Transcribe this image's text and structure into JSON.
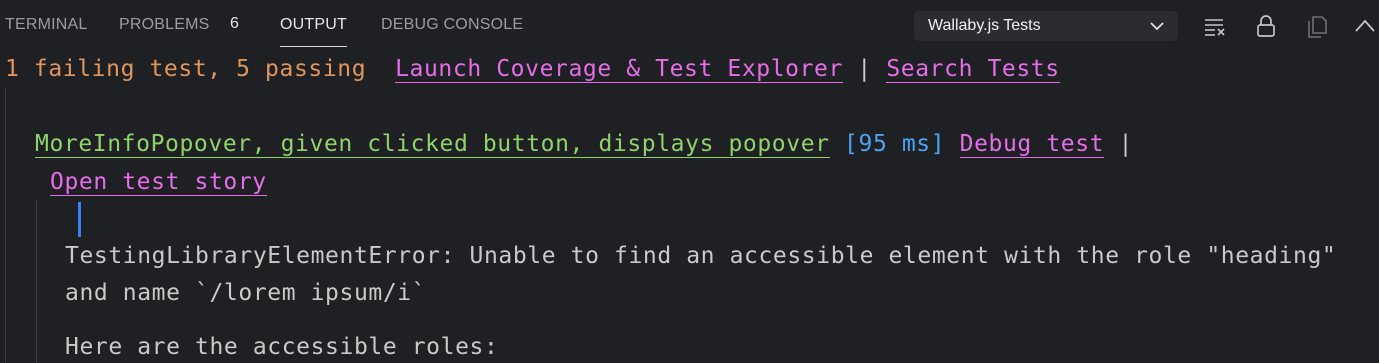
{
  "tabs": {
    "terminal": "TERMINAL",
    "problems": "PROBLEMS",
    "problems_count": "6",
    "output": "OUTPUT",
    "debug_console": "DEBUG CONSOLE"
  },
  "output_channel": {
    "selected": "Wallaby.js Tests"
  },
  "toolbar_icons": [
    "clear-output-icon",
    "lock-icon",
    "copy-icon",
    "chevron-up-icon"
  ],
  "summary": {
    "status": "1 failing test, 5 passing",
    "launch_link": "Launch Coverage & Test Explorer",
    "separator": "|",
    "search_link": "Search Tests"
  },
  "test": {
    "name": "MoreInfoPopover, given clicked button, displays popover",
    "duration": "[95 ms]",
    "debug_link": "Debug test",
    "separator": "|",
    "story_link": "Open test story"
  },
  "error": {
    "line1": "TestingLibraryElementError: Unable to find an accessible element with the role \"heading\"",
    "line2": "and name `/lorem ipsum/i`",
    "line3": "Here are the accessible roles:"
  },
  "colors": {
    "background": "#1f2024",
    "failing": "#e0955a",
    "passing_test": "#8fd26a",
    "link": "#e56de7",
    "duration": "#4ba3f4",
    "caret": "#3b82f6"
  }
}
